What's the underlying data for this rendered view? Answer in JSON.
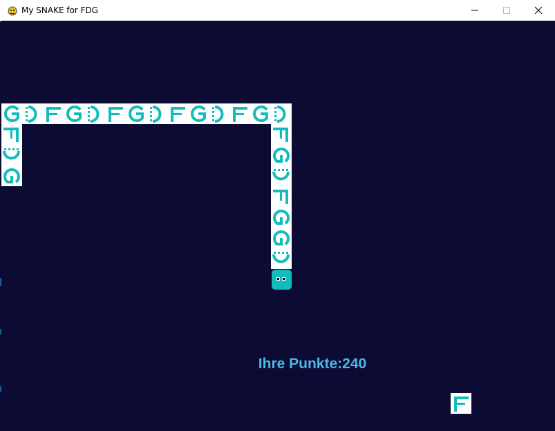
{
  "window": {
    "title": "My SNAKE for FDG",
    "app_icon": "pygame-snake-icon",
    "controls": [
      "minimize-icon",
      "maximize-icon",
      "close-icon"
    ]
  },
  "game": {
    "score_text": "Ihre Punkte:240",
    "colors": {
      "background": "#0b0b33",
      "tile_background": "#ffffff",
      "glyph": "#13bcbc",
      "head": "#13bcbc",
      "score": "#4db8e8"
    },
    "snake_body_letters": [
      "G",
      "D",
      "F",
      "G",
      "D",
      "F",
      "G",
      "D",
      "F",
      "G",
      "D",
      "F",
      "G",
      "D",
      "F",
      "G",
      "D",
      "F",
      "G",
      "D",
      "F",
      "G"
    ],
    "food_letter": "F"
  }
}
